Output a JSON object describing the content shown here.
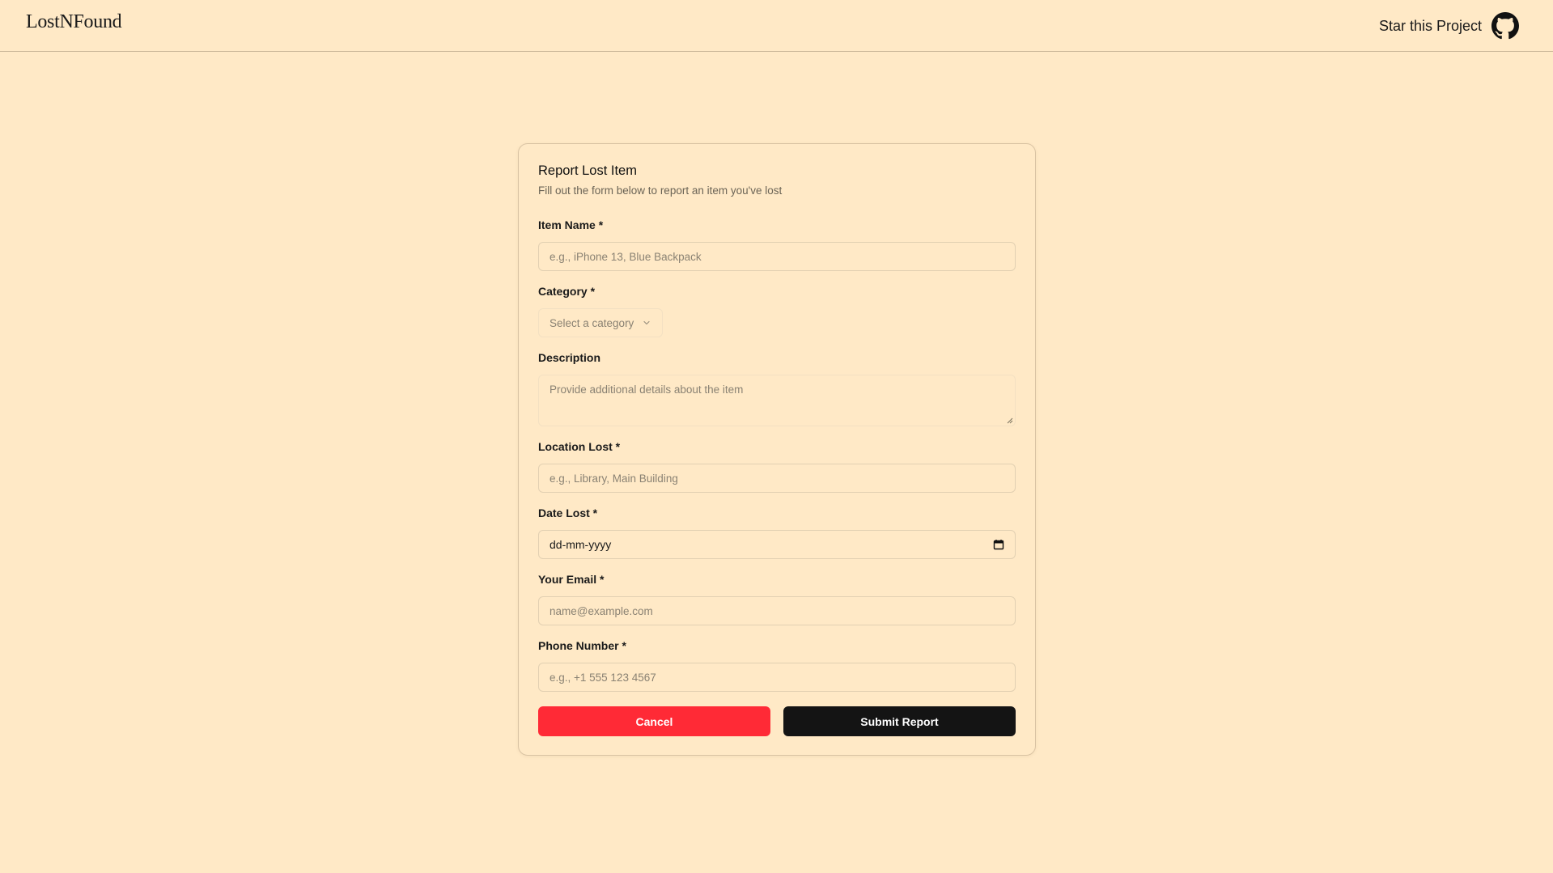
{
  "header": {
    "brand": "LostNFound",
    "star_label": "Star this Project",
    "star_icon": "github-icon"
  },
  "form": {
    "title": "Report Lost Item",
    "subtitle": "Fill out the form below to report an item you've lost",
    "item_name": {
      "label": "Item Name *",
      "placeholder": "e.g., iPhone 13, Blue Backpack",
      "value": ""
    },
    "category": {
      "label": "Category *",
      "placeholder": "Select a category",
      "icon": "chevron-down-icon"
    },
    "description": {
      "label": "Description",
      "placeholder": "Provide additional details about the item",
      "value": ""
    },
    "location": {
      "label": "Location Lost *",
      "placeholder": "e.g., Library, Main Building",
      "value": ""
    },
    "date": {
      "label": "Date Lost *",
      "placeholder": "dd-mm-yyyy",
      "icon": "calendar-icon"
    },
    "email": {
      "label": "Your Email *",
      "placeholder": "name@example.com",
      "value": ""
    },
    "phone": {
      "label": "Phone Number *",
      "placeholder": "e.g., +1 555 123 4567",
      "value": ""
    },
    "cancel_label": "Cancel",
    "submit_label": "Submit Report"
  },
  "colors": {
    "background": "#FFE9C6",
    "cancel": "#FF2A36",
    "submit": "#141414"
  }
}
